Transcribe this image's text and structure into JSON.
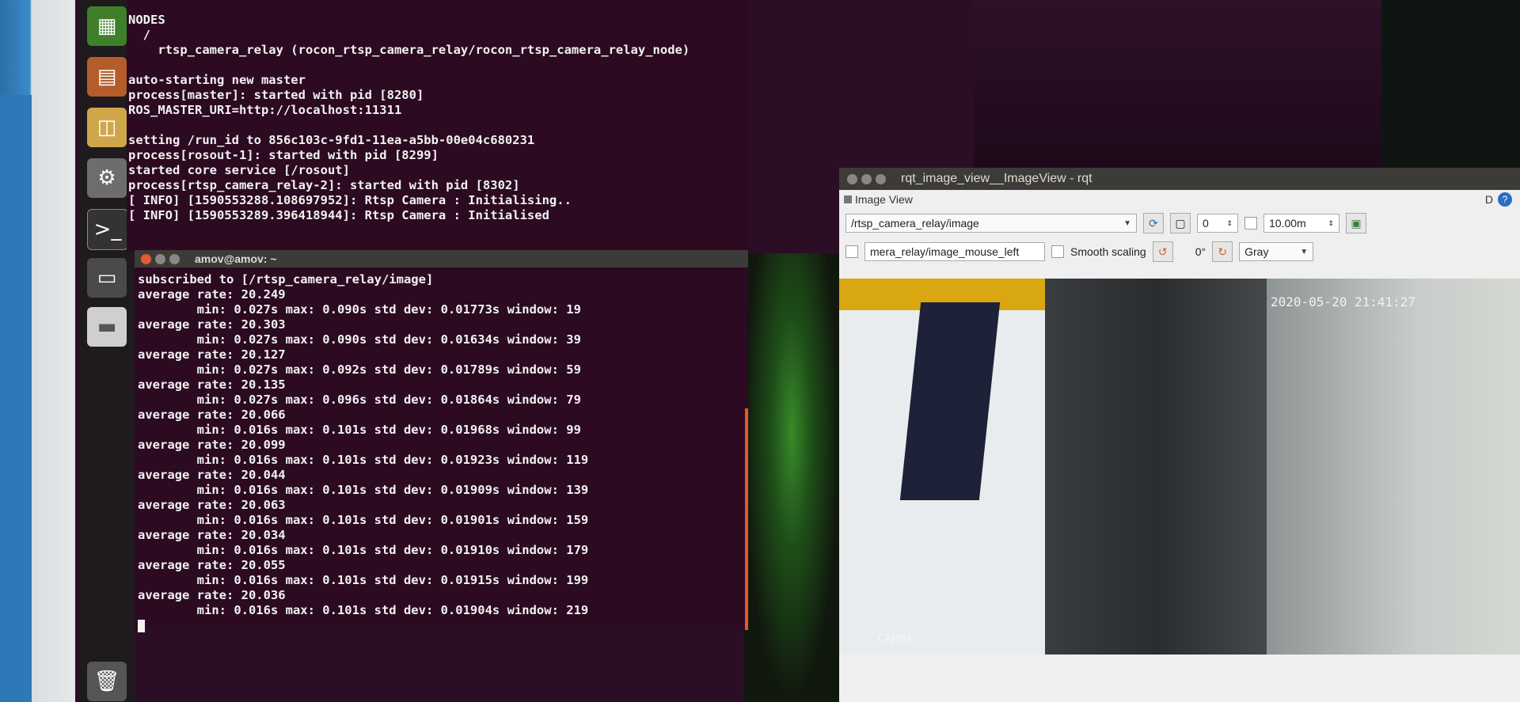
{
  "term1": {
    "lines": [
      "NODES",
      "  /",
      "    rtsp_camera_relay (rocon_rtsp_camera_relay/rocon_rtsp_camera_relay_node)",
      "",
      "auto-starting new master",
      "process[master]: started with pid [8280]",
      "ROS_MASTER_URI=http://localhost:11311",
      "",
      "setting /run_id to 856c103c-9fd1-11ea-a5bb-00e04c680231",
      "process[rosout-1]: started with pid [8299]",
      "started core service [/rosout]",
      "process[rtsp_camera_relay-2]: started with pid [8302]",
      "[ INFO] [1590553288.108697952]: Rtsp Camera : Initialising..",
      "[ INFO] [1590553289.396418944]: Rtsp Camera : Initialised"
    ]
  },
  "term2": {
    "title": "amov@amov: ~",
    "lines": [
      "subscribed to [/rtsp_camera_relay/image]",
      "average rate: 20.249",
      "        min: 0.027s max: 0.090s std dev: 0.01773s window: 19",
      "average rate: 20.303",
      "        min: 0.027s max: 0.090s std dev: 0.01634s window: 39",
      "average rate: 20.127",
      "        min: 0.027s max: 0.092s std dev: 0.01789s window: 59",
      "average rate: 20.135",
      "        min: 0.027s max: 0.096s std dev: 0.01864s window: 79",
      "average rate: 20.066",
      "        min: 0.016s max: 0.101s std dev: 0.01968s window: 99",
      "average rate: 20.099",
      "        min: 0.016s max: 0.101s std dev: 0.01923s window: 119",
      "average rate: 20.044",
      "        min: 0.016s max: 0.101s std dev: 0.01909s window: 139",
      "average rate: 20.063",
      "        min: 0.016s max: 0.101s std dev: 0.01901s window: 159",
      "average rate: 20.034",
      "        min: 0.016s max: 0.101s std dev: 0.01910s window: 179",
      "average rate: 20.055",
      "        min: 0.016s max: 0.101s std dev: 0.01915s window: 199",
      "average rate: 20.036",
      "        min: 0.016s max: 0.101s std dev: 0.01904s window: 219"
    ]
  },
  "rqt": {
    "title": "rqt_image_view__ImageView - rqt",
    "panel_title": "Image View",
    "topic": "/rtsp_camera_relay/image",
    "spin_value": "0",
    "zoom_value": "10.00m",
    "mouse_topic": "mera_relay/image_mouse_left",
    "smooth_label": "Smooth scaling",
    "rotation": "0°",
    "colormap": "Gray",
    "panel_d": "D",
    "help": "?",
    "timestamp": "2020-05-20 21:41:27",
    "camera_label": "CAM01"
  },
  "colors": {
    "terminal_bg": "#2c0a22",
    "titlebar": "#3c3b37",
    "close": "#e2583b",
    "scrollbar": "#e45a2a"
  },
  "icons": [
    "spreadsheet-icon",
    "presentation-icon",
    "software-center-icon",
    "system-settings-icon",
    "terminal-icon",
    "monitor-icon",
    "drive-icon",
    "trash-icon"
  ]
}
